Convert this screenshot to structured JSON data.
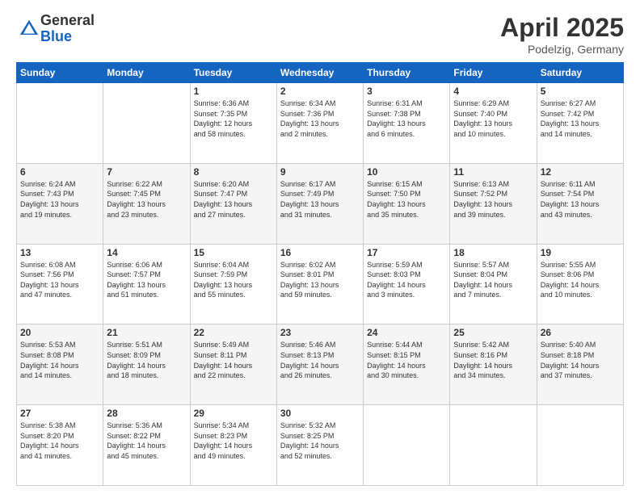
{
  "logo": {
    "general": "General",
    "blue": "Blue"
  },
  "title": {
    "month_year": "April 2025",
    "location": "Podelzig, Germany"
  },
  "weekdays": [
    "Sunday",
    "Monday",
    "Tuesday",
    "Wednesday",
    "Thursday",
    "Friday",
    "Saturday"
  ],
  "weeks": [
    [
      {
        "day": "",
        "info": ""
      },
      {
        "day": "",
        "info": ""
      },
      {
        "day": "1",
        "info": "Sunrise: 6:36 AM\nSunset: 7:35 PM\nDaylight: 12 hours\nand 58 minutes."
      },
      {
        "day": "2",
        "info": "Sunrise: 6:34 AM\nSunset: 7:36 PM\nDaylight: 13 hours\nand 2 minutes."
      },
      {
        "day": "3",
        "info": "Sunrise: 6:31 AM\nSunset: 7:38 PM\nDaylight: 13 hours\nand 6 minutes."
      },
      {
        "day": "4",
        "info": "Sunrise: 6:29 AM\nSunset: 7:40 PM\nDaylight: 13 hours\nand 10 minutes."
      },
      {
        "day": "5",
        "info": "Sunrise: 6:27 AM\nSunset: 7:42 PM\nDaylight: 13 hours\nand 14 minutes."
      }
    ],
    [
      {
        "day": "6",
        "info": "Sunrise: 6:24 AM\nSunset: 7:43 PM\nDaylight: 13 hours\nand 19 minutes."
      },
      {
        "day": "7",
        "info": "Sunrise: 6:22 AM\nSunset: 7:45 PM\nDaylight: 13 hours\nand 23 minutes."
      },
      {
        "day": "8",
        "info": "Sunrise: 6:20 AM\nSunset: 7:47 PM\nDaylight: 13 hours\nand 27 minutes."
      },
      {
        "day": "9",
        "info": "Sunrise: 6:17 AM\nSunset: 7:49 PM\nDaylight: 13 hours\nand 31 minutes."
      },
      {
        "day": "10",
        "info": "Sunrise: 6:15 AM\nSunset: 7:50 PM\nDaylight: 13 hours\nand 35 minutes."
      },
      {
        "day": "11",
        "info": "Sunrise: 6:13 AM\nSunset: 7:52 PM\nDaylight: 13 hours\nand 39 minutes."
      },
      {
        "day": "12",
        "info": "Sunrise: 6:11 AM\nSunset: 7:54 PM\nDaylight: 13 hours\nand 43 minutes."
      }
    ],
    [
      {
        "day": "13",
        "info": "Sunrise: 6:08 AM\nSunset: 7:56 PM\nDaylight: 13 hours\nand 47 minutes."
      },
      {
        "day": "14",
        "info": "Sunrise: 6:06 AM\nSunset: 7:57 PM\nDaylight: 13 hours\nand 51 minutes."
      },
      {
        "day": "15",
        "info": "Sunrise: 6:04 AM\nSunset: 7:59 PM\nDaylight: 13 hours\nand 55 minutes."
      },
      {
        "day": "16",
        "info": "Sunrise: 6:02 AM\nSunset: 8:01 PM\nDaylight: 13 hours\nand 59 minutes."
      },
      {
        "day": "17",
        "info": "Sunrise: 5:59 AM\nSunset: 8:03 PM\nDaylight: 14 hours\nand 3 minutes."
      },
      {
        "day": "18",
        "info": "Sunrise: 5:57 AM\nSunset: 8:04 PM\nDaylight: 14 hours\nand 7 minutes."
      },
      {
        "day": "19",
        "info": "Sunrise: 5:55 AM\nSunset: 8:06 PM\nDaylight: 14 hours\nand 10 minutes."
      }
    ],
    [
      {
        "day": "20",
        "info": "Sunrise: 5:53 AM\nSunset: 8:08 PM\nDaylight: 14 hours\nand 14 minutes."
      },
      {
        "day": "21",
        "info": "Sunrise: 5:51 AM\nSunset: 8:09 PM\nDaylight: 14 hours\nand 18 minutes."
      },
      {
        "day": "22",
        "info": "Sunrise: 5:49 AM\nSunset: 8:11 PM\nDaylight: 14 hours\nand 22 minutes."
      },
      {
        "day": "23",
        "info": "Sunrise: 5:46 AM\nSunset: 8:13 PM\nDaylight: 14 hours\nand 26 minutes."
      },
      {
        "day": "24",
        "info": "Sunrise: 5:44 AM\nSunset: 8:15 PM\nDaylight: 14 hours\nand 30 minutes."
      },
      {
        "day": "25",
        "info": "Sunrise: 5:42 AM\nSunset: 8:16 PM\nDaylight: 14 hours\nand 34 minutes."
      },
      {
        "day": "26",
        "info": "Sunrise: 5:40 AM\nSunset: 8:18 PM\nDaylight: 14 hours\nand 37 minutes."
      }
    ],
    [
      {
        "day": "27",
        "info": "Sunrise: 5:38 AM\nSunset: 8:20 PM\nDaylight: 14 hours\nand 41 minutes."
      },
      {
        "day": "28",
        "info": "Sunrise: 5:36 AM\nSunset: 8:22 PM\nDaylight: 14 hours\nand 45 minutes."
      },
      {
        "day": "29",
        "info": "Sunrise: 5:34 AM\nSunset: 8:23 PM\nDaylight: 14 hours\nand 49 minutes."
      },
      {
        "day": "30",
        "info": "Sunrise: 5:32 AM\nSunset: 8:25 PM\nDaylight: 14 hours\nand 52 minutes."
      },
      {
        "day": "",
        "info": ""
      },
      {
        "day": "",
        "info": ""
      },
      {
        "day": "",
        "info": ""
      }
    ]
  ]
}
